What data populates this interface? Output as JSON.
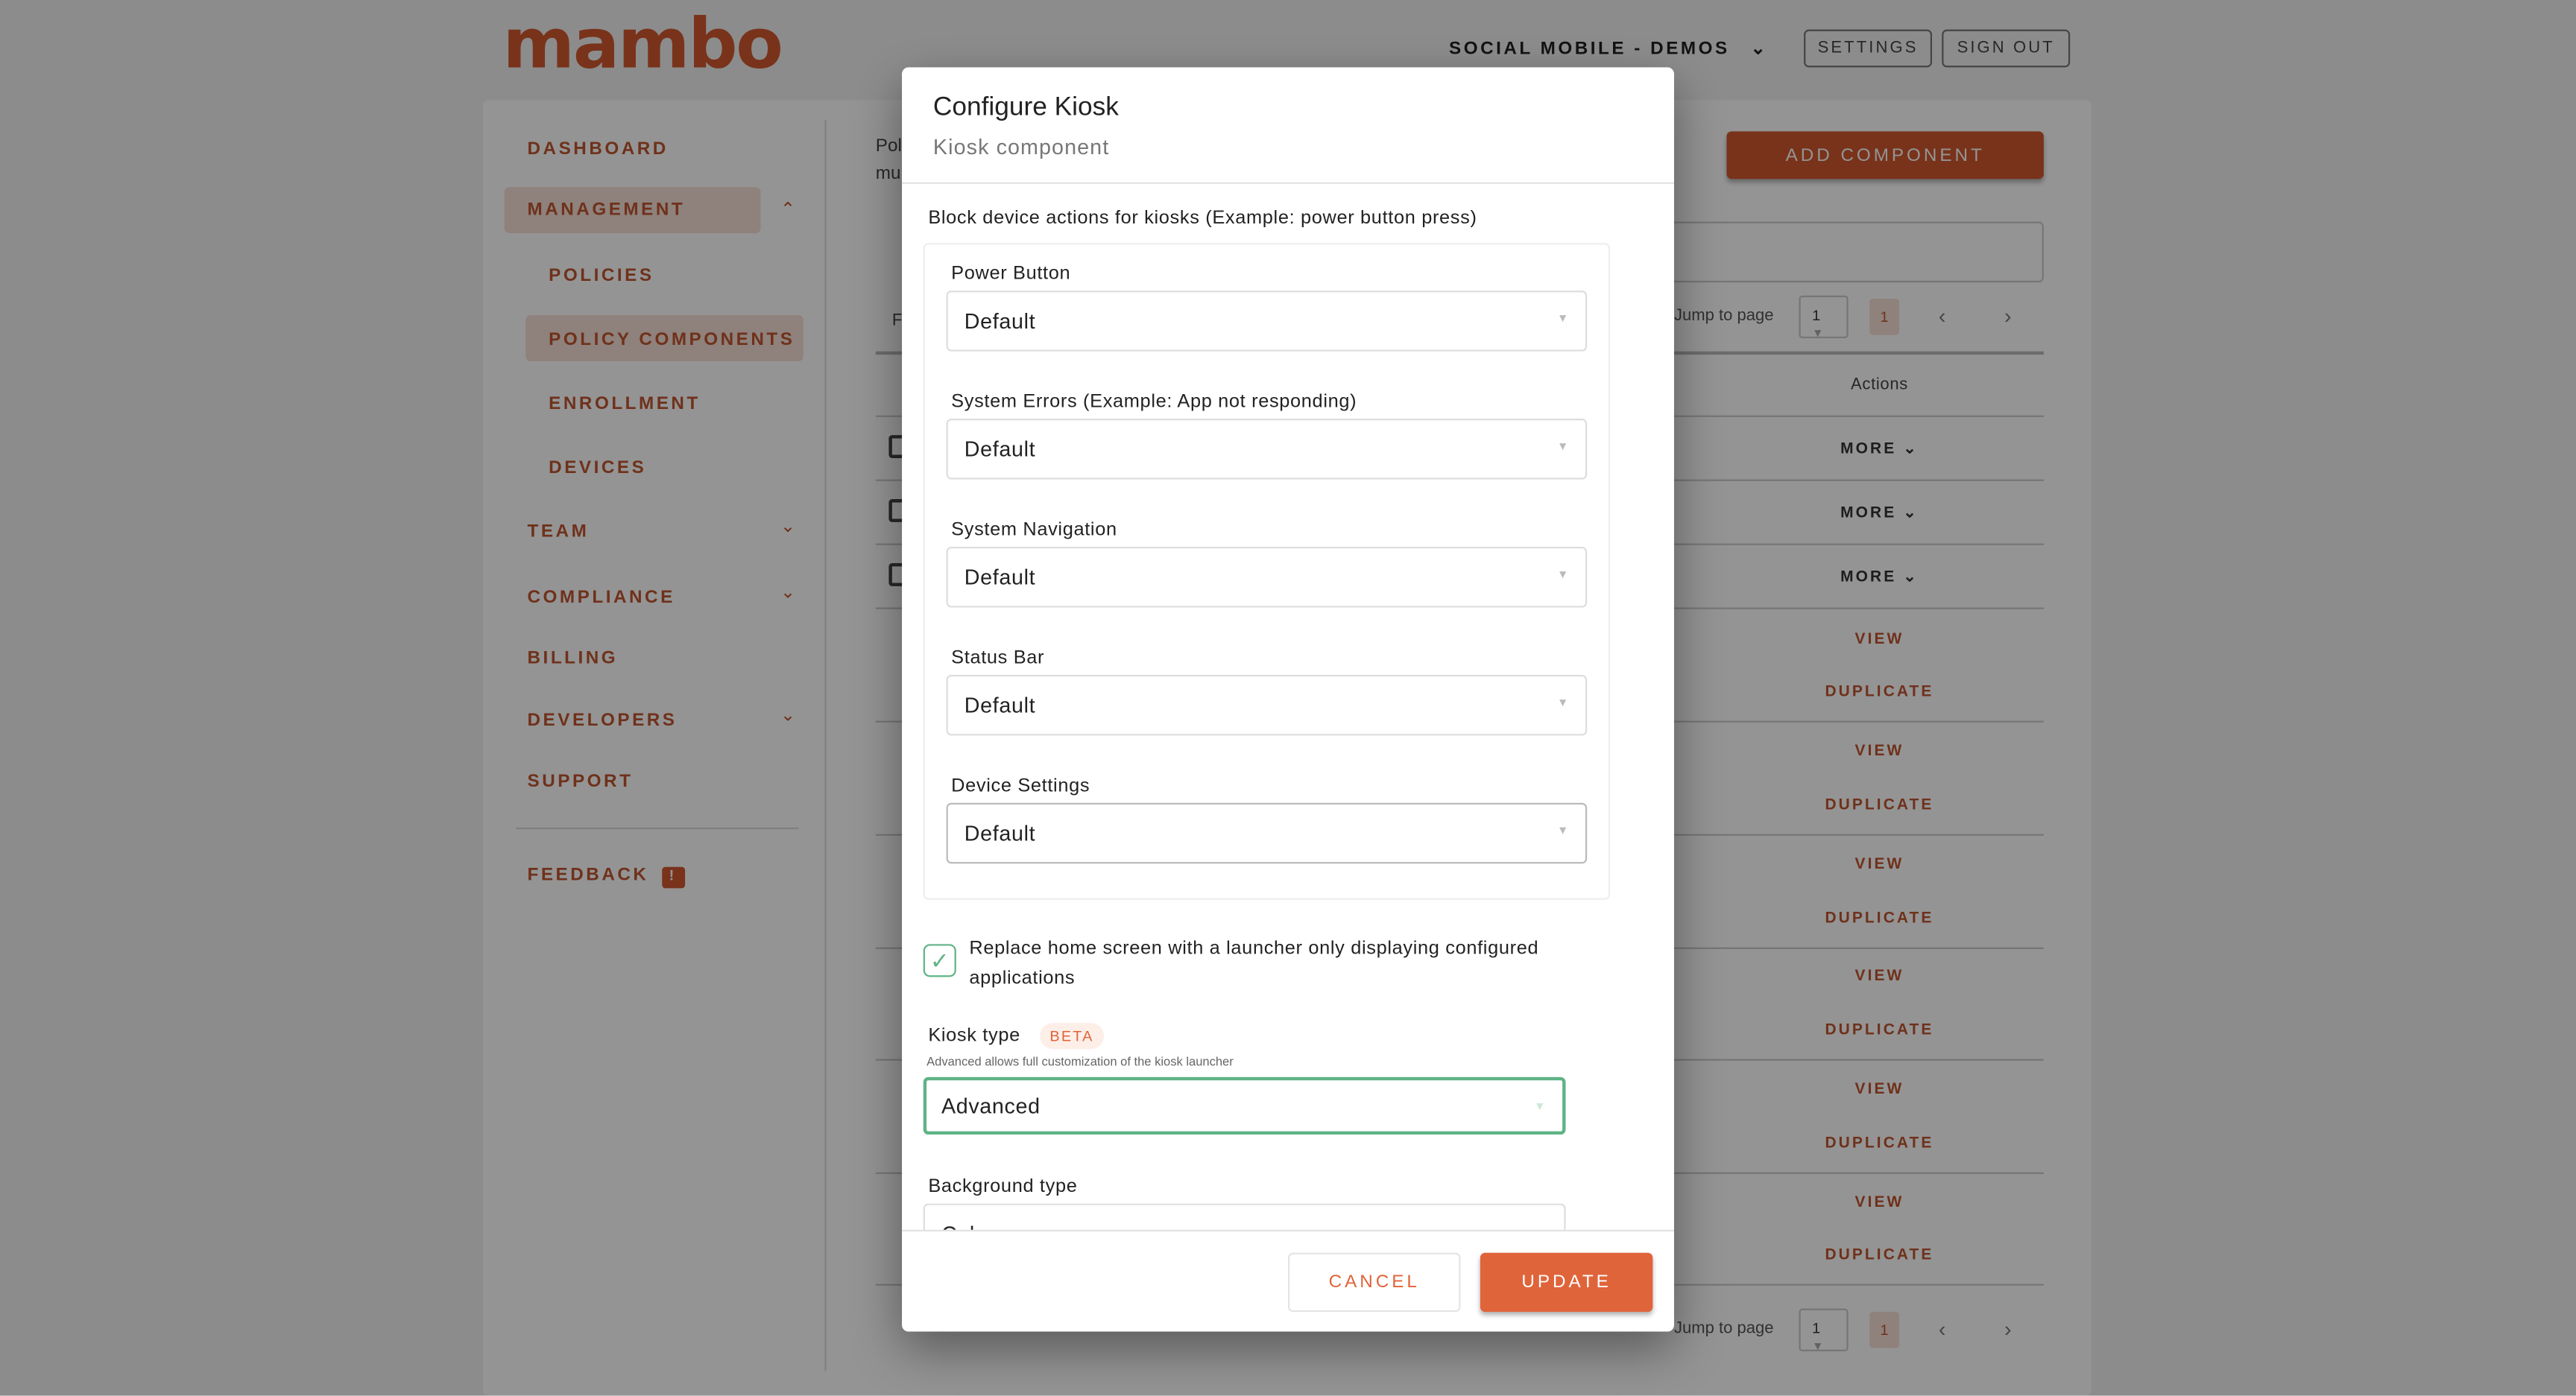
{
  "brand": {
    "logo": "mambo",
    "color": "#d0582f"
  },
  "header": {
    "org": "SOCIAL MOBILE - DEMOS",
    "settings": "SETTINGS",
    "signout": "SIGN OUT"
  },
  "sidebar": {
    "items": [
      {
        "label": "DASHBOARD"
      },
      {
        "label": "MANAGEMENT",
        "expanded": true
      },
      {
        "label": "POLICIES"
      },
      {
        "label": "POLICY COMPONENTS",
        "active": true
      },
      {
        "label": "ENROLLMENT"
      },
      {
        "label": "DEVICES"
      },
      {
        "label": "TEAM"
      },
      {
        "label": "COMPLIANCE"
      },
      {
        "label": "BILLING"
      },
      {
        "label": "DEVELOPERS"
      },
      {
        "label": "SUPPORT"
      }
    ],
    "feedback": "FEEDBACK",
    "feedback_badge": "!"
  },
  "main": {
    "intro_1": "Pol",
    "intro_2": "mu",
    "filter_letter": "F",
    "add_button": "ADD COMPONENT",
    "pagination": {
      "jump_label": "Jump to page",
      "page_select": "1",
      "current": "1"
    },
    "table": {
      "actions_header": "Actions",
      "more": "MORE",
      "view": "VIEW",
      "duplicate": "DUPLICATE"
    }
  },
  "modal": {
    "title": "Configure Kiosk",
    "subtitle": "Kiosk component",
    "block_label": "Block device actions for kiosks (Example: power button press)",
    "fields": [
      {
        "label": "Power Button",
        "value": "Default"
      },
      {
        "label": "System Errors (Example: App not responding)",
        "value": "Default"
      },
      {
        "label": "System Navigation",
        "value": "Default"
      },
      {
        "label": "Status Bar",
        "value": "Default"
      },
      {
        "label": "Device Settings",
        "value": "Default"
      }
    ],
    "launcher_checkbox": {
      "label": "Replace home screen with a launcher only displaying configured applications",
      "checked": true
    },
    "kiosk_type": {
      "label": "Kiosk type",
      "badge": "BETA",
      "helper": "Advanced allows full customization of the kiosk launcher",
      "value": "Advanced",
      "focus_color": "#5fb386"
    },
    "background_type": {
      "label": "Background type",
      "value": "Color"
    },
    "cancel": "CANCEL",
    "update": "UPDATE",
    "update_color": "#e0643a"
  }
}
